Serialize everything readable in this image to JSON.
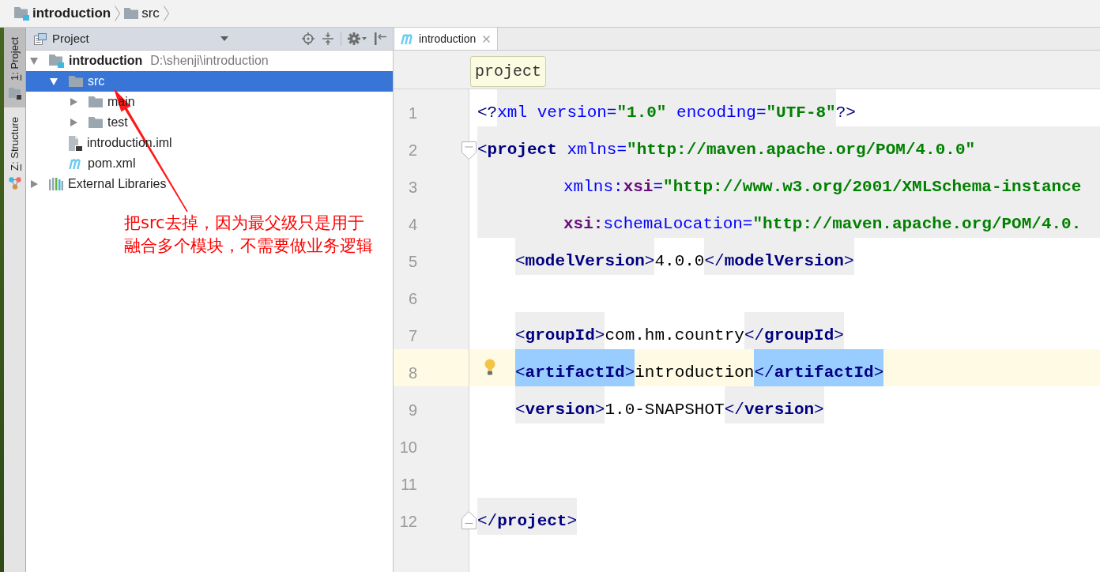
{
  "breadcrumbs": [
    {
      "label": "introduction",
      "kind": "module"
    },
    {
      "label": "src",
      "kind": "folder"
    }
  ],
  "tool_windows": [
    {
      "label": "1: Project",
      "kind": "project",
      "selected": true
    },
    {
      "label": "Z: Structure",
      "kind": "structure",
      "selected": false
    }
  ],
  "project_panel": {
    "title": "Project",
    "tree": [
      {
        "label": "introduction",
        "path": "D:\\shenji\\introduction",
        "kind": "module",
        "expanded": true,
        "selected": false,
        "children": [
          {
            "label": "src",
            "kind": "folder",
            "expanded": true,
            "selected": true,
            "children": [
              {
                "label": "main",
                "kind": "folder",
                "expanded": false,
                "selected": false
              },
              {
                "label": "test",
                "kind": "folder",
                "expanded": false,
                "selected": false
              }
            ]
          },
          {
            "label": "introduction.iml",
            "kind": "iml",
            "selected": false
          },
          {
            "label": "pom.xml",
            "kind": "maven",
            "selected": false
          }
        ]
      },
      {
        "label": "External Libraries",
        "kind": "libraries",
        "expanded": false,
        "selected": false
      }
    ]
  },
  "annotation": {
    "lines": [
      "把src去掉，因为最父级只是用于",
      "融合多个模块，不需要做业务逻辑"
    ]
  },
  "editor": {
    "tabs": [
      {
        "label": "introduction",
        "selected": true
      }
    ],
    "breadcrumbs": [
      {
        "label": "project"
      }
    ],
    "lines": [
      {
        "number": "1",
        "kind": "code",
        "current": false,
        "shaded": false,
        "tokens": [
          {
            "text": "<?",
            "kind": "bracket",
            "shaded": false,
            "matched": false
          },
          {
            "text": "xml version=",
            "kind": "attr",
            "shaded": true,
            "matched": false
          },
          {
            "text": "\"1.0\" ",
            "kind": "value",
            "shaded": true,
            "matched": false
          },
          {
            "text": "encoding=",
            "kind": "attr",
            "shaded": true,
            "matched": false
          },
          {
            "text": "\"UTF-8\"",
            "kind": "value",
            "shaded": true,
            "matched": false
          },
          {
            "text": "?>",
            "kind": "bracket",
            "shaded": false,
            "matched": false
          }
        ]
      },
      {
        "number": "2",
        "kind": "code",
        "fold_marker": {
          "kind": "start"
        },
        "current": false,
        "shaded": true,
        "tokens": [
          {
            "text": "<",
            "kind": "bracket",
            "matched": false
          },
          {
            "text": "project ",
            "kind": "tag",
            "matched": false
          },
          {
            "text": "xmlns=",
            "kind": "attr",
            "matched": false
          },
          {
            "text": "\"http://maven.apache.org/POM/4.0.0\"",
            "kind": "value",
            "matched": false
          }
        ],
        "children": [
          {
            "number": "3",
            "kind": "continuation",
            "current": false,
            "shaded": true,
            "tokens": [
              {
                "text": "xmlns:",
                "kind": "attr",
                "matched": false
              },
              {
                "text": "xsi",
                "kind": "ns",
                "matched": false
              },
              {
                "text": "=",
                "kind": "attr",
                "matched": false
              },
              {
                "text": "\"http://www.w3.org/2001/XMLSchema-instance",
                "kind": "value",
                "matched": false
              }
            ]
          },
          {
            "number": "4",
            "kind": "continuation",
            "current": false,
            "shaded": true,
            "tokens": [
              {
                "text": "xsi:",
                "kind": "ns",
                "matched": false
              },
              {
                "text": "schemaLocation=",
                "kind": "attr",
                "matched": false
              },
              {
                "text": "\"http://maven.apache.org/POM/4.0.",
                "kind": "value",
                "matched": false
              }
            ]
          },
          {
            "number": "5",
            "kind": "code",
            "current": false,
            "shaded": false,
            "tokens": [
              {
                "text": "<",
                "kind": "bracket",
                "shaded": true,
                "matched": false
              },
              {
                "text": "modelVersion",
                "kind": "tag",
                "shaded": true,
                "matched": false
              },
              {
                "text": ">",
                "kind": "bracket",
                "shaded": true,
                "matched": false
              },
              {
                "text": "4.0.0",
                "kind": "text",
                "shaded": false,
                "matched": false
              },
              {
                "text": "</",
                "kind": "bracket",
                "shaded": true,
                "matched": false
              },
              {
                "text": "modelVersion",
                "kind": "tag",
                "shaded": true,
                "matched": false
              },
              {
                "text": ">",
                "kind": "bracket",
                "shaded": true,
                "matched": false
              }
            ]
          },
          {
            "number": "6",
            "kind": "code",
            "current": false,
            "shaded": false
          },
          {
            "number": "7",
            "kind": "code",
            "current": false,
            "shaded": false,
            "tokens": [
              {
                "text": "<",
                "kind": "bracket",
                "shaded": true,
                "matched": false
              },
              {
                "text": "groupId",
                "kind": "tag",
                "shaded": true,
                "matched": false
              },
              {
                "text": ">",
                "kind": "bracket",
                "shaded": true,
                "matched": false
              },
              {
                "text": "com.hm.country",
                "kind": "text",
                "shaded": false,
                "matched": false
              },
              {
                "text": "</",
                "kind": "bracket",
                "shaded": true,
                "matched": false
              },
              {
                "text": "groupId",
                "kind": "tag",
                "shaded": true,
                "matched": false
              },
              {
                "text": ">",
                "kind": "bracket",
                "shaded": true,
                "matched": false
              }
            ]
          },
          {
            "number": "8",
            "kind": "code",
            "current": true,
            "bulb": true,
            "shaded": false,
            "tokens": [
              {
                "text": "<",
                "kind": "bracket",
                "matched": true
              },
              {
                "text": "artifactId",
                "kind": "tag",
                "matched": true
              },
              {
                "text": ">",
                "kind": "bracket",
                "matched": true
              },
              {
                "text": "introduction",
                "kind": "text",
                "shaded": false,
                "matched": false
              },
              {
                "text": "</",
                "kind": "bracket",
                "matched": true
              },
              {
                "text": "artifactId",
                "kind": "tag",
                "matched": true
              },
              {
                "text": ">",
                "kind": "bracket",
                "matched": true
              }
            ]
          },
          {
            "number": "9",
            "kind": "code",
            "current": false,
            "shaded": false,
            "tokens": [
              {
                "text": "<",
                "kind": "bracket",
                "shaded": true,
                "matched": false
              },
              {
                "text": "version",
                "kind": "tag",
                "shaded": true,
                "matched": false
              },
              {
                "text": ">",
                "kind": "bracket",
                "shaded": true,
                "matched": false
              },
              {
                "text": "1.0-SNAPSHOT",
                "kind": "text",
                "shaded": false,
                "matched": false
              },
              {
                "text": "</",
                "kind": "bracket",
                "shaded": true,
                "matched": false
              },
              {
                "text": "version",
                "kind": "tag",
                "shaded": true,
                "matched": false
              },
              {
                "text": ">",
                "kind": "bracket",
                "shaded": true,
                "matched": false
              }
            ]
          }
        ]
      },
      {
        "number": "10",
        "kind": "code",
        "current": false,
        "shaded": false
      },
      {
        "number": "11",
        "kind": "code",
        "current": false,
        "shaded": false
      },
      {
        "number": "12",
        "kind": "code",
        "fold_marker": {
          "kind": "end"
        },
        "current": false,
        "shaded": false,
        "tokens": [
          {
            "text": "</",
            "kind": "bracket",
            "shaded": true,
            "matched": false
          },
          {
            "text": "project",
            "kind": "tag",
            "shaded": true,
            "matched": false
          },
          {
            "text": ">",
            "kind": "bracket",
            "shaded": true,
            "matched": false
          }
        ]
      }
    ]
  }
}
